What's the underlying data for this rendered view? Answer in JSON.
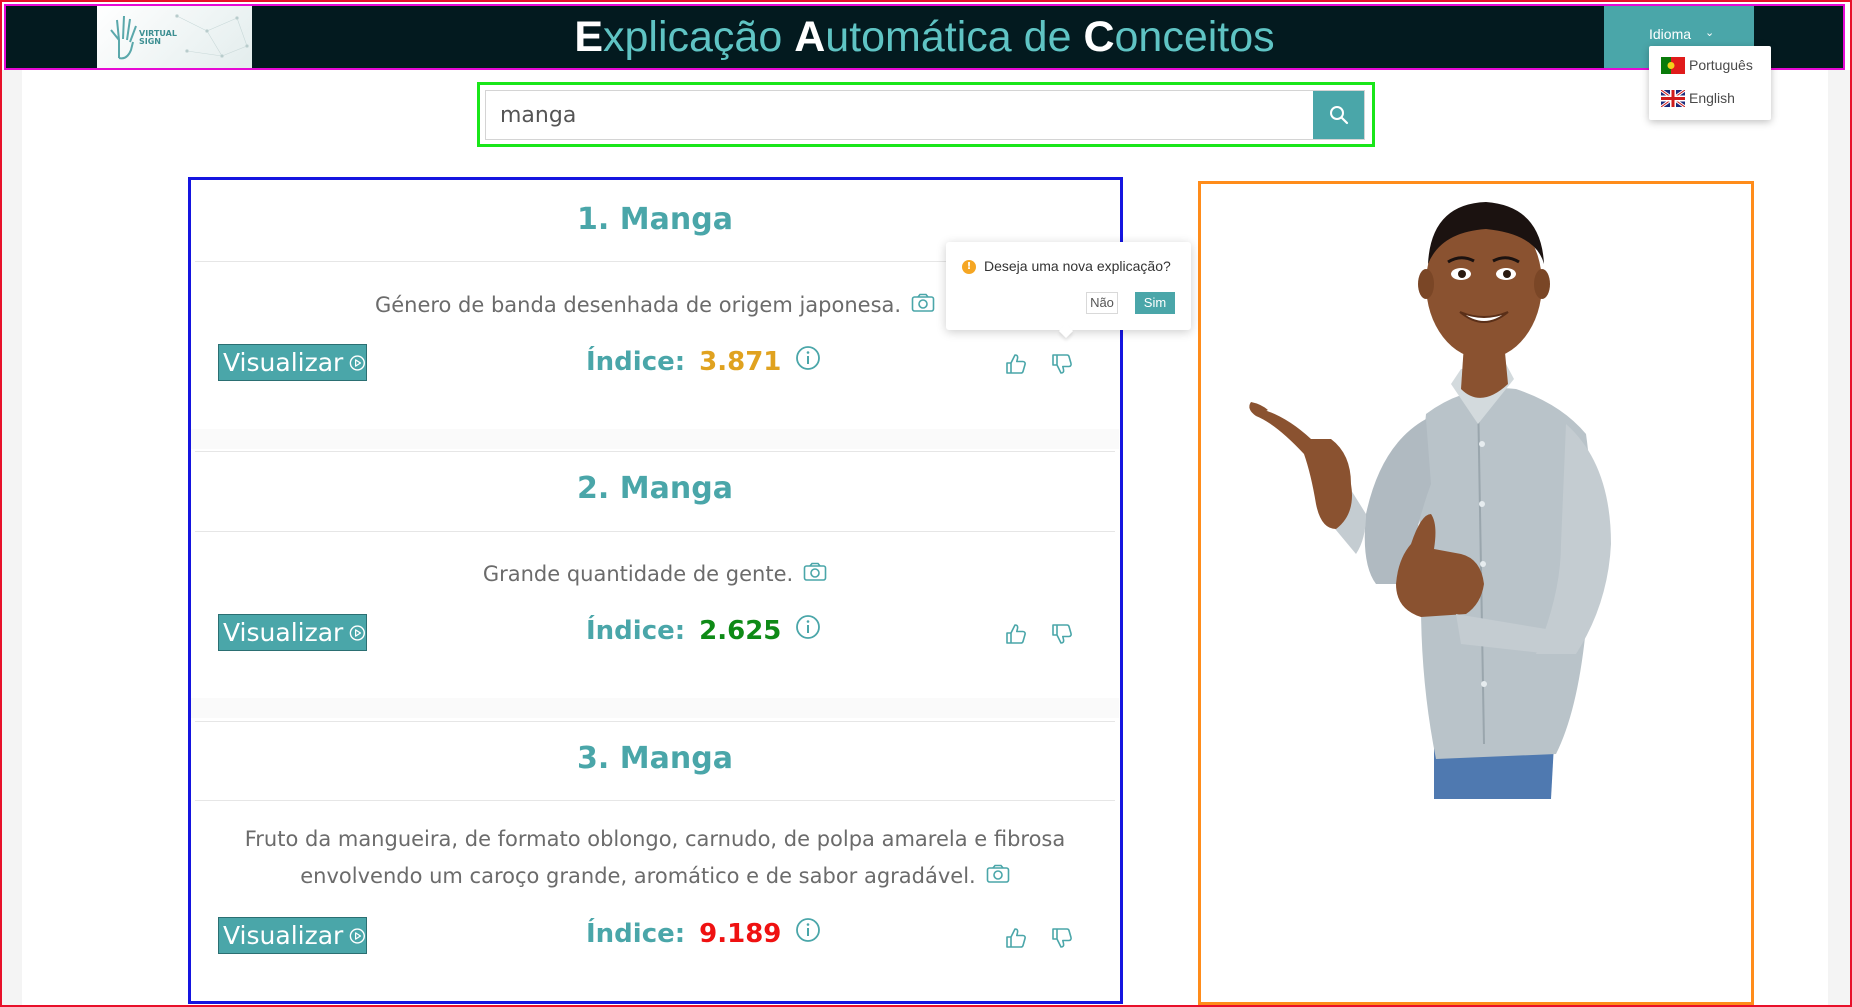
{
  "header": {
    "title_parts": [
      {
        "cap": "E",
        "rest": "xplicação "
      },
      {
        "cap": "A",
        "rest": "utomática de "
      },
      {
        "cap": "C",
        "rest": "onceitos"
      }
    ],
    "logo_text_line1": "VIRTUAL",
    "logo_text_line2": "SIGN",
    "language_button": "Idioma",
    "language_options": [
      "Português",
      "English"
    ]
  },
  "search": {
    "value": "manga"
  },
  "results": [
    {
      "title": "1. Manga",
      "description": "Género de banda desenhada de origem japonesa.",
      "visualize_label": "Visualizar",
      "index_label": "Índice:",
      "index_value": "3.871",
      "index_color": "#e0a21f"
    },
    {
      "title": "2. Manga",
      "description": "Grande quantidade de gente.",
      "visualize_label": "Visualizar",
      "index_label": "Índice:",
      "index_value": "2.625",
      "index_color": "#0e8a16"
    },
    {
      "title": "3. Manga",
      "description_line1": "Fruto da mangueira, de formato oblongo, carnudo, de polpa amarela e fibrosa",
      "description_line2": "envolvendo um caroço grande, aromático e de sabor agradável.",
      "visualize_label": "Visualizar",
      "index_label": "Índice:",
      "index_value": "9.189",
      "index_color": "#ef1111"
    }
  ],
  "popover": {
    "message": "Deseja uma nova explicação?",
    "no_label": "Não",
    "yes_label": "Sim"
  },
  "colors": {
    "accent": "#4aa6a9",
    "header_bg": "#031a1f",
    "title_teal": "#5fc4c4"
  }
}
